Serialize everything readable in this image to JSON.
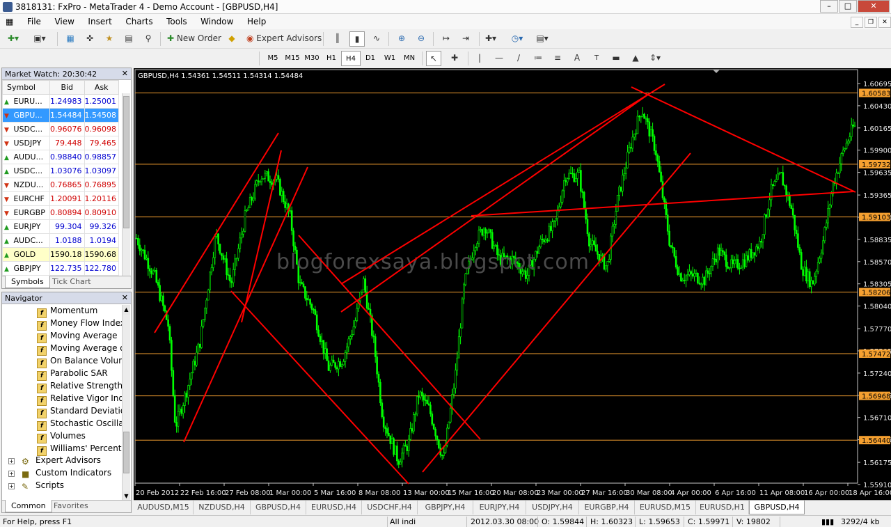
{
  "window": {
    "title": "3818131: FxPro - MetaTrader 4 - Demo Account - [GBPUSD,H4]"
  },
  "menu": [
    "File",
    "View",
    "Insert",
    "Charts",
    "Tools",
    "Window",
    "Help"
  ],
  "toolbar": {
    "new_order": "New Order",
    "expert_advisors": "Expert Advisors"
  },
  "timeframes": [
    "M5",
    "M15",
    "M30",
    "H1",
    "H4",
    "D1",
    "W1",
    "MN"
  ],
  "active_timeframe": "H4",
  "market_watch": {
    "title": "Market Watch: 20:30:42",
    "columns": [
      "Symbol",
      "Bid",
      "Ask"
    ],
    "rows": [
      {
        "symbol": "EURU...",
        "bid": "1.24983",
        "ask": "1.25001",
        "dir": "up",
        "color": "blue"
      },
      {
        "symbol": "GBPU...",
        "bid": "1.54484",
        "ask": "1.54508",
        "dir": "dn",
        "color": "blue",
        "selected": true
      },
      {
        "symbol": "USDC...",
        "bid": "0.96076",
        "ask": "0.96098",
        "dir": "dn",
        "color": "red"
      },
      {
        "symbol": "USDJPY",
        "bid": "79.448",
        "ask": "79.465",
        "dir": "dn",
        "color": "red"
      },
      {
        "symbol": "AUDU...",
        "bid": "0.98840",
        "ask": "0.98857",
        "dir": "up",
        "color": "blue"
      },
      {
        "symbol": "USDC...",
        "bid": "1.03076",
        "ask": "1.03097",
        "dir": "up",
        "color": "blue"
      },
      {
        "symbol": "NZDU...",
        "bid": "0.76865",
        "ask": "0.76895",
        "dir": "dn",
        "color": "red"
      },
      {
        "symbol": "EURCHF",
        "bid": "1.20091",
        "ask": "1.20116",
        "dir": "dn",
        "color": "red"
      },
      {
        "symbol": "EURGBP",
        "bid": "0.80894",
        "ask": "0.80910",
        "dir": "dn",
        "color": "red"
      },
      {
        "symbol": "EURJPY",
        "bid": "99.304",
        "ask": "99.326",
        "dir": "up",
        "color": "blue"
      },
      {
        "symbol": "AUDC...",
        "bid": "1.0188",
        "ask": "1.0194",
        "dir": "up",
        "color": "blue"
      },
      {
        "symbol": "GOLD",
        "bid": "1590.18",
        "ask": "1590.68",
        "dir": "up",
        "color": "black",
        "gold": true
      },
      {
        "symbol": "GBPJPY",
        "bid": "122.735",
        "ask": "122.780",
        "dir": "up",
        "color": "blue"
      }
    ],
    "tabs": [
      "Symbols",
      "Tick Chart"
    ]
  },
  "navigator": {
    "title": "Navigator",
    "indicators": [
      "Momentum",
      "Money Flow Index",
      "Moving Average",
      "Moving Average o",
      "On Balance Volum",
      "Parabolic SAR",
      "Relative Strength I",
      "Relative Vigor Inde",
      "Standard Deviatio",
      "Stochastic Oscillat",
      "Volumes",
      "Williams' Percent R"
    ],
    "groups": [
      "Expert Advisors",
      "Custom Indicators",
      "Scripts"
    ],
    "tabs": [
      "Common",
      "Favorites"
    ]
  },
  "chart": {
    "header": "GBPUSD,H4  1.54361 1.54511 1.54314 1.54484",
    "watermark": "blogforexsaya.blogspot.com",
    "price_ticks": [
      "1.60695",
      "1.60430",
      "1.60165",
      "1.59900",
      "1.59635",
      "1.59365",
      "1.59100",
      "1.58835",
      "1.58570",
      "1.58305",
      "1.58040",
      "1.57770",
      "1.57505",
      "1.57240",
      "1.56975",
      "1.56710",
      "1.56445",
      "1.56175",
      "1.55910"
    ],
    "hlines": [
      "1.60583",
      "1.59732",
      "1.59103",
      "1.58206",
      "1.57472",
      "1.56968",
      "1.56440"
    ],
    "date_ticks": [
      "20 Feb 2012",
      "22 Feb 16:00",
      "27 Feb 08:00",
      "1 Mar 00:00",
      "5 Mar 16:00",
      "8 Mar 08:00",
      "13 Mar 00:00",
      "15 Mar 16:00",
      "20 Mar 08:00",
      "23 Mar 00:00",
      "27 Mar 16:00",
      "30 Mar 08:00",
      "4 Apr 00:00",
      "6 Apr 16:00",
      "11 Apr 08:00",
      "16 Apr 00:00",
      "18 Apr 16:00"
    ]
  },
  "chart_tabs": [
    "AUDUSD,M15",
    "NZDUSD,H4",
    "GBPUSD,H4",
    "EURUSD,H4",
    "USDCHF,H4",
    "GBPJPY,H4",
    "EURJPY,H4",
    "USDJPY,H4",
    "EURGBP,H4",
    "EURUSD,M15",
    "EURUSD,H1",
    "GBPUSD,H4"
  ],
  "status": {
    "help": "For Help, press F1",
    "profile": "All indi",
    "time": "2012.03.30 08:00",
    "open": "O: 1.59844",
    "high": "H: 1.60323",
    "low": "L: 1.59653",
    "close": "C: 1.59971",
    "volume": "V: 19802",
    "traffic": "3292/4 kb"
  },
  "colors": {
    "candle": "#00ff00",
    "trendline": "#ff0000",
    "hline": "#f5a030",
    "tag_bg": "#f5a030"
  }
}
